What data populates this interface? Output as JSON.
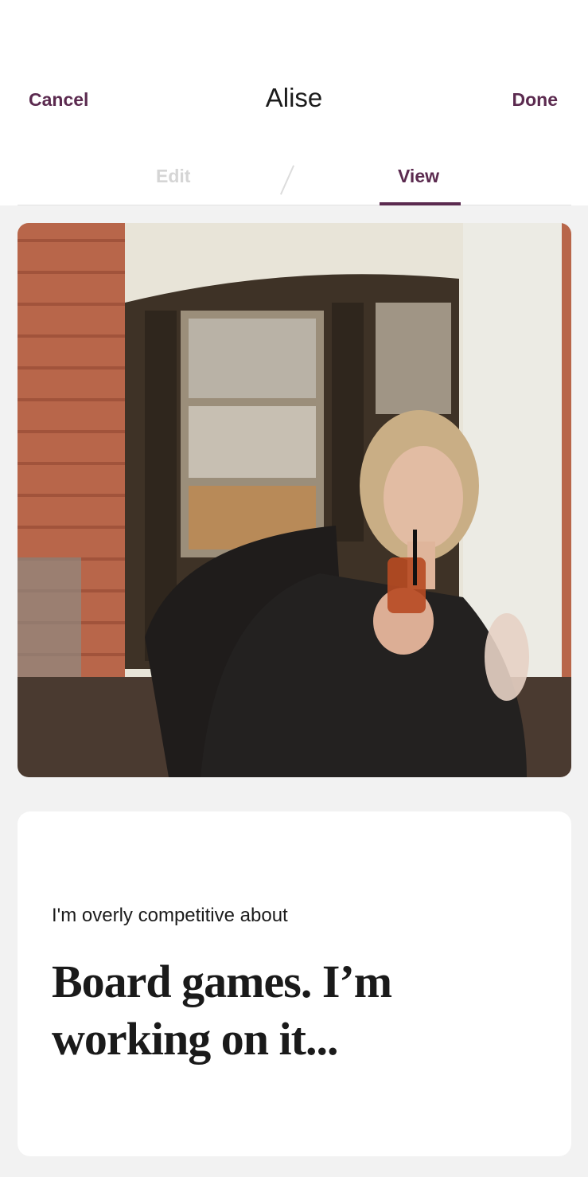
{
  "header": {
    "cancel_label": "Cancel",
    "title": "Alise",
    "done_label": "Done"
  },
  "tabs": [
    {
      "label": "Edit",
      "active": false
    },
    {
      "label": "View",
      "active": true
    }
  ],
  "colors": {
    "accent": "#5b2a4f",
    "inactive_tab": "#d5d5d5",
    "background": "#f2f2f2"
  },
  "profile_card": {
    "prompt": "I'm overly competitive about",
    "answer": "Board games. I’m working on it..."
  }
}
